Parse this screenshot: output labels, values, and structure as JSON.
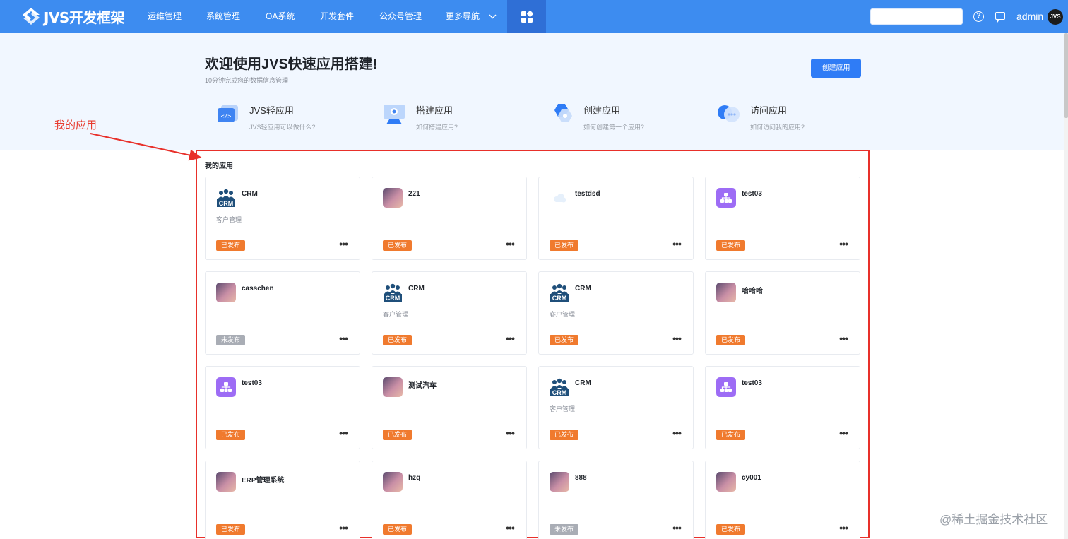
{
  "nav": {
    "logo_text": "JVS开发框架",
    "items": [
      "运维管理",
      "系统管理",
      "OA系统",
      "开发套件",
      "公众号管理"
    ],
    "more_label": "更多导航",
    "search_placeholder": "",
    "help_symbol": "?",
    "user_name": "admin",
    "avatar_text": "JVS"
  },
  "hero": {
    "title": "欢迎使用JVS快速应用搭建!",
    "subtitle": "10分钟完成您的数据信息管理",
    "create_button": "创建应用",
    "features": [
      {
        "title": "JVS轻应用",
        "desc": "JVS轻应用可以做什么?",
        "icon": "code-window-icon"
      },
      {
        "title": "搭建应用",
        "desc": "如何搭建应用?",
        "icon": "monitor-icon"
      },
      {
        "title": "创建应用",
        "desc": "如何创建第一个应用?",
        "icon": "hexagon-gear-icon"
      },
      {
        "title": "访问应用",
        "desc": "如何访问我的应用?",
        "icon": "chat-bubble-icon"
      }
    ]
  },
  "annotation": {
    "label": "我的应用"
  },
  "section_title": "我的应用",
  "apps": [
    {
      "name": "CRM",
      "desc": "客户管理",
      "icon": "crm",
      "status": "已发布",
      "published": true
    },
    {
      "name": "221",
      "desc": "",
      "icon": "grad",
      "status": "已发布",
      "published": true
    },
    {
      "name": "testdsd",
      "desc": "",
      "icon": "cloud",
      "status": "已发布",
      "published": true
    },
    {
      "name": "test03",
      "desc": "",
      "icon": "purple",
      "status": "已发布",
      "published": true
    },
    {
      "name": "casschen",
      "desc": "",
      "icon": "grad",
      "status": "未发布",
      "published": false
    },
    {
      "name": "CRM",
      "desc": "客户管理",
      "icon": "crm",
      "status": "已发布",
      "published": true
    },
    {
      "name": "CRM",
      "desc": "客户管理",
      "icon": "crm",
      "status": "已发布",
      "published": true
    },
    {
      "name": "哈哈哈",
      "desc": "",
      "icon": "grad",
      "status": "已发布",
      "published": true
    },
    {
      "name": "test03",
      "desc": "",
      "icon": "purple",
      "status": "已发布",
      "published": true
    },
    {
      "name": "测试汽车",
      "desc": "",
      "icon": "grad",
      "status": "已发布",
      "published": true
    },
    {
      "name": "CRM",
      "desc": "客户管理",
      "icon": "crm",
      "status": "已发布",
      "published": true
    },
    {
      "name": "test03",
      "desc": "",
      "icon": "purple",
      "status": "已发布",
      "published": true
    },
    {
      "name": "ERP管理系统",
      "desc": "",
      "icon": "grad",
      "status": "已发布",
      "published": true
    },
    {
      "name": "hzq",
      "desc": "",
      "icon": "grad",
      "status": "已发布",
      "published": true
    },
    {
      "name": "888",
      "desc": "",
      "icon": "grad",
      "status": "未发布",
      "published": false
    },
    {
      "name": "cy001",
      "desc": "",
      "icon": "grad",
      "status": "已发布",
      "published": true
    }
  ],
  "watermark": "@稀土掘金技术社区",
  "colors": {
    "nav_bg": "#3d8cf0",
    "nav_active": "#2f6fd6",
    "hero_bg": "#f1f7ff",
    "primary": "#2f7cf6",
    "published": "#f07a2e",
    "unpublished": "#a9adb5",
    "annotation": "#e8302a"
  }
}
